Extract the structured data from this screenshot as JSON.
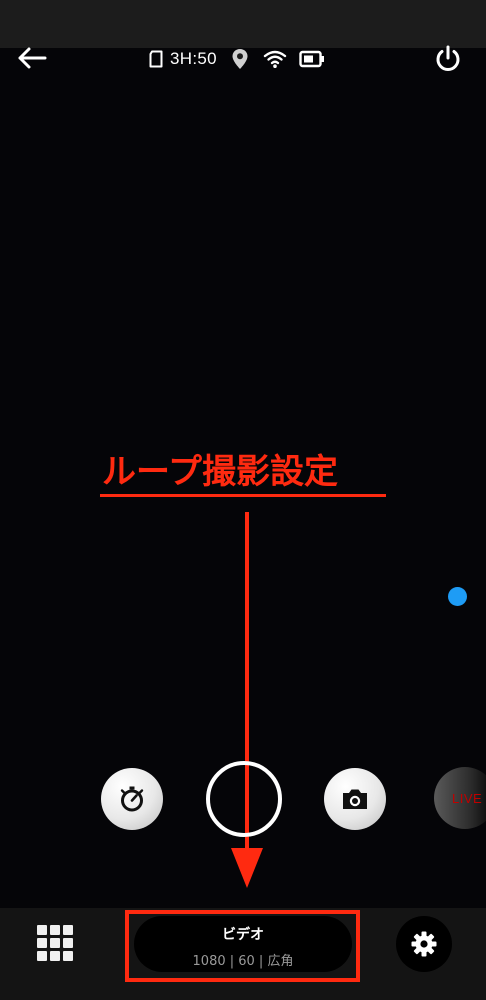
{
  "status_bar": {
    "remaining_time": "3H:50"
  },
  "icons": {
    "back": "arrow-left-icon",
    "sd_card": "sd-card-icon",
    "gps": "location-pin-icon",
    "wifi": "wifi-icon",
    "battery": "battery-icon",
    "power": "power-icon",
    "timer": "timer-icon",
    "photo": "camera-icon",
    "grid": "grid-icon",
    "settings": "gear-icon"
  },
  "annotation": {
    "label": "ループ撮影設定",
    "color": "#ff2a10"
  },
  "controls": {
    "live_label": "LIVE"
  },
  "mode": {
    "title": "ビデオ",
    "details": "1080 | 60 | 広角"
  },
  "colors": {
    "accent_blue": "#1e9cf5",
    "annotation_red": "#ff2a10",
    "live_red": "#c00000"
  }
}
